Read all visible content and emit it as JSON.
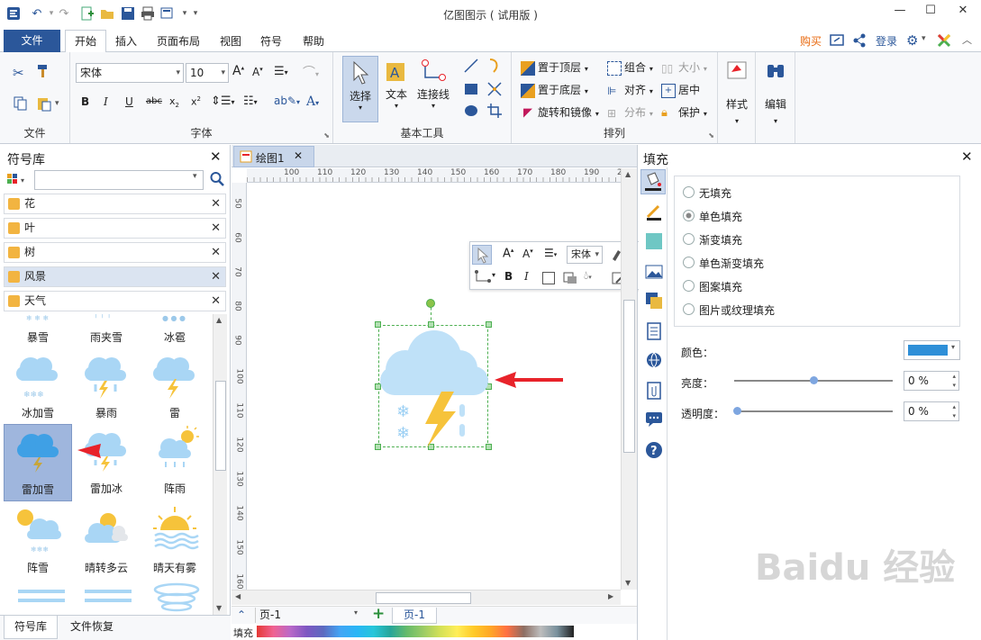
{
  "window": {
    "title": "亿图图示 ( 试用版 )",
    "controls": [
      "—",
      "☐",
      "✕"
    ]
  },
  "menu": {
    "file": "文件",
    "tabs": [
      "开始",
      "插入",
      "页面布局",
      "视图",
      "符号",
      "帮助"
    ],
    "right": {
      "buy": "购买",
      "login": "登录"
    }
  },
  "ribbon": {
    "groups": {
      "file": "文件",
      "font": "字体",
      "basic_tools": "基本工具",
      "arrange": "排列"
    },
    "font_name": "宋体",
    "font_size": "10",
    "tools": {
      "select": "选择",
      "text": "文本",
      "connector": "连接线"
    },
    "arrange": {
      "bring_front": "置于顶层",
      "send_back": "置于底层",
      "rotate": "旋转和镜像",
      "group": "组合",
      "align": "对齐",
      "distribute": "分布",
      "size": "大小",
      "center": "居中",
      "protect": "保护"
    },
    "style": "样式",
    "edit": "编辑"
  },
  "library": {
    "title": "符号库",
    "search_placeholder": "",
    "categories": [
      "花",
      "叶",
      "树",
      "风景",
      "天气"
    ],
    "selected_category": "风景",
    "symbols_row0": [
      "暴雪",
      "雨夹雪",
      "冰雹"
    ],
    "symbols_row1": [
      "冰加雪",
      "暴雨",
      "雷"
    ],
    "symbols_row2": [
      "雷加雪",
      "雷加冰",
      "阵雨"
    ],
    "symbols_row3": [
      "阵雪",
      "晴转多云",
      "晴天有雾"
    ],
    "bottom_tabs": [
      "符号库",
      "文件恢复"
    ]
  },
  "canvas": {
    "tab": "绘图1",
    "ruler_h": [
      "100",
      "110",
      "120",
      "130",
      "140",
      "150",
      "160",
      "170",
      "180",
      "190",
      "200"
    ],
    "ruler_v": [
      "50",
      "60",
      "70",
      "80",
      "90",
      "100",
      "110",
      "120",
      "130",
      "140",
      "150",
      "160"
    ],
    "page_select": "页-1",
    "page_tab": "页-1",
    "fill_label": "填充",
    "mini_font": "宋体"
  },
  "fill_panel": {
    "title": "填充",
    "options": [
      "无填充",
      "单色填充",
      "渐变填充",
      "单色渐变填充",
      "图案填充",
      "图片或纹理填充"
    ],
    "selected": "单色填充",
    "color_label": "颜色：",
    "color": "#2e8fd8",
    "brightness_label": "亮度：",
    "brightness": "0 %",
    "transparency_label": "透明度：",
    "transparency": "0 %"
  },
  "colors": {
    "accent": "#2b579a",
    "arrow": "#e8232a",
    "cloud": "#bfe1f8",
    "lightning": "#f6c33b",
    "selection": "#4caf50"
  }
}
